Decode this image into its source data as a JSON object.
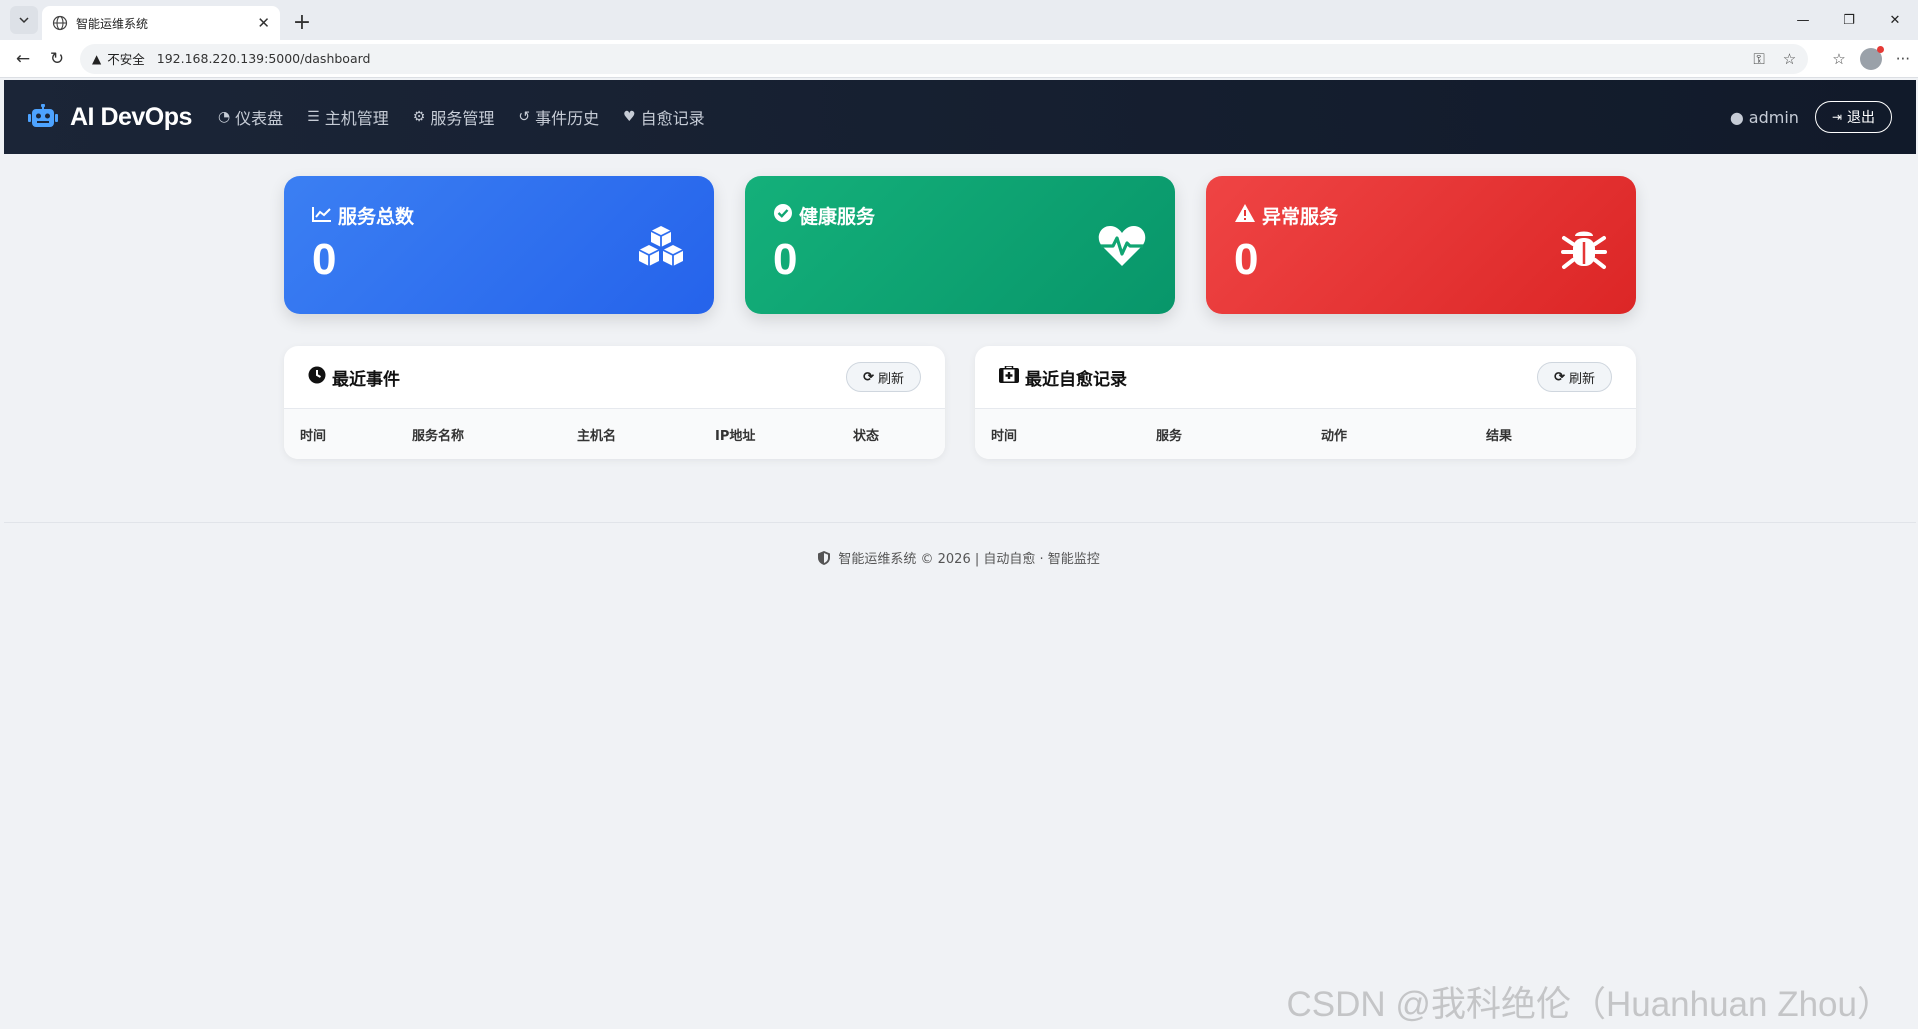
{
  "browser": {
    "tab_title": "智能运维系统",
    "url_warning": "不安全",
    "url": "192.168.220.139:5000/dashboard"
  },
  "nav": {
    "brand": "AI DevOps",
    "items": [
      {
        "label": "仪表盘",
        "icon": "dashboard-icon"
      },
      {
        "label": "主机管理",
        "icon": "server-icon"
      },
      {
        "label": "服务管理",
        "icon": "cogs-icon"
      },
      {
        "label": "事件历史",
        "icon": "history-icon"
      },
      {
        "label": "自愈记录",
        "icon": "heartbeat-icon"
      }
    ],
    "user": "admin",
    "logout": "退出"
  },
  "stats": [
    {
      "title": "服务总数",
      "value": "0",
      "color": "#2f6ff0",
      "icon": "cubes-icon"
    },
    {
      "title": "健康服务",
      "value": "0",
      "color": "#10a572",
      "icon": "heart-pulse-icon"
    },
    {
      "title": "异常服务",
      "value": "0",
      "color": "#e53535",
      "icon": "bug-icon"
    }
  ],
  "events_panel": {
    "title": "最近事件",
    "refresh": "刷新",
    "columns": [
      "时间",
      "服务名称",
      "主机名",
      "IP地址",
      "状态"
    ]
  },
  "healing_panel": {
    "title": "最近自愈记录",
    "refresh": "刷新",
    "columns": [
      "时间",
      "服务",
      "动作",
      "结果"
    ]
  },
  "footer": "智能运维系统 © 2026 | 自动自愈 · 智能监控",
  "watermark": "CSDN @我科绝伦（Huanhuan Zhou）"
}
